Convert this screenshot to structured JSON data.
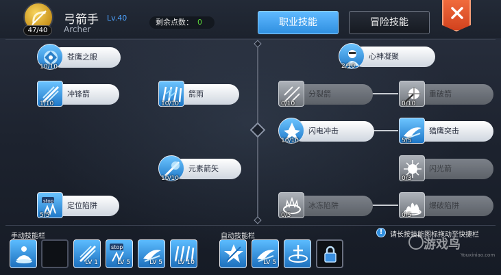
{
  "header": {
    "points_badge": "47/40",
    "class_name": "弓箭手",
    "class_level": "Lv.40",
    "class_english": "Archer",
    "remaining_points_label": "剩余点数：",
    "remaining_points_value": "0",
    "tabs": [
      {
        "label": "职业技能",
        "active": true
      },
      {
        "label": "冒险技能",
        "active": false
      }
    ],
    "close_icon": "close-icon"
  },
  "left_skills": [
    {
      "name": "苍鹰之眼",
      "level": "10/10",
      "icon": "hawk-eye-icon",
      "locked": false
    },
    {
      "name": "冲锋箭",
      "level": "1/10",
      "icon": "charge-arrow-icon",
      "locked": false
    },
    {
      "name": "箭雨",
      "level": "10/10",
      "icon": "arrow-rain-icon",
      "locked": false
    },
    {
      "name": "元素箭矢",
      "level": "10/10",
      "icon": "element-arrow-icon",
      "locked": false
    },
    {
      "name": "定位陷阱",
      "level": "5/5",
      "icon": "locate-trap-icon",
      "locked": false
    }
  ],
  "right_skills": [
    {
      "name": "心神凝聚",
      "level": "2/10",
      "icon": "focus-icon",
      "locked": false
    },
    {
      "name": "分裂箭",
      "level": "0/10",
      "icon": "split-arrow-icon",
      "locked": true
    },
    {
      "name": "重破箭",
      "level": "0/10",
      "icon": "break-arrow-icon",
      "locked": true
    },
    {
      "name": "闪电冲击",
      "level": "10/10",
      "icon": "lightning-strike-icon",
      "locked": false
    },
    {
      "name": "猎鹰突击",
      "level": "5/5",
      "icon": "falcon-assault-icon",
      "locked": false
    },
    {
      "name": "闪光箭",
      "level": "0/3",
      "icon": "flash-arrow-icon",
      "locked": true
    },
    {
      "name": "冰冻陷阱",
      "level": "0/5",
      "icon": "frost-trap-icon",
      "locked": true
    },
    {
      "name": "爆破陷阱",
      "level": "0/5",
      "icon": "blast-trap-icon",
      "locked": true
    }
  ],
  "bottom": {
    "manual_label": "手动技能栏",
    "auto_label": "自动技能栏",
    "manual_slots": [
      {
        "icon": "meditate-icon",
        "level": ""
      },
      {
        "icon": "empty-slot",
        "level": ""
      },
      {
        "icon": "charge-arrow-icon",
        "level": "LV 1"
      },
      {
        "icon": "locate-trap-icon",
        "level": "LV 5"
      },
      {
        "icon": "falcon-assault-icon",
        "level": "LV 5"
      },
      {
        "icon": "arrow-rain-icon",
        "level": "LV 10"
      }
    ],
    "auto_slots": [
      {
        "icon": "buff-burst-icon",
        "level": ""
      },
      {
        "icon": "falcon-assault-icon",
        "level": "LV 5"
      },
      {
        "icon": "target-aura-icon",
        "level": ""
      },
      {
        "icon": "lock-icon",
        "level": ""
      }
    ],
    "hint_text": "请长按技能图标拖动至快捷栏",
    "watermark": "游戏鸟",
    "watermark_sub": "Youxiniao.com"
  },
  "colors": {
    "accent_blue": "#2f8fe0",
    "level_blue": "#4da3ff",
    "points_green": "#5ddc3a",
    "close_orange": "#e2522a"
  }
}
